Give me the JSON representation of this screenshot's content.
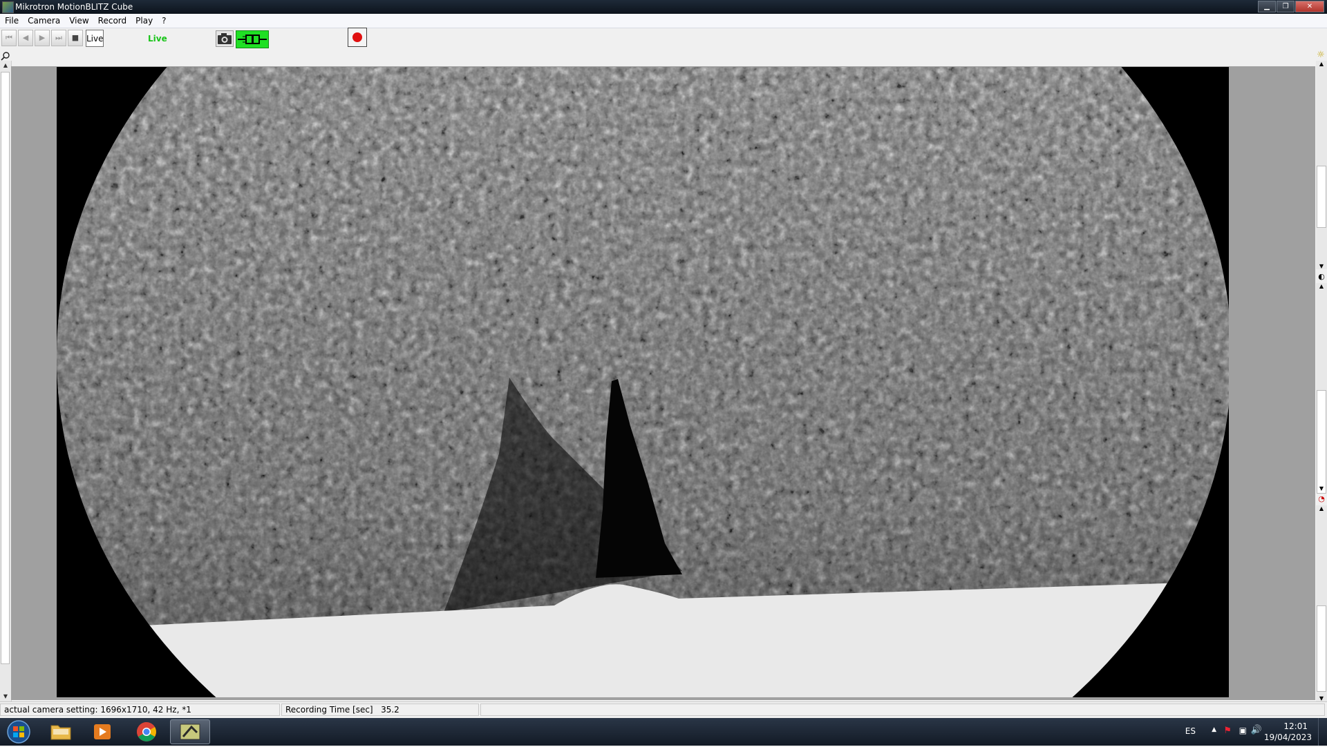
{
  "window": {
    "title": "Mikrotron MotionBLITZ Cube",
    "controls": [
      "minimize",
      "maximize",
      "close"
    ]
  },
  "menu": {
    "items": [
      "File",
      "Camera",
      "View",
      "Record",
      "Play",
      "?"
    ]
  },
  "toolbar": {
    "buttons": [
      {
        "name": "go-to-start-icon",
        "glyph": "⏮"
      },
      {
        "name": "step-back-icon",
        "glyph": "◀|"
      },
      {
        "name": "play-icon",
        "glyph": "▶"
      },
      {
        "name": "step-forward-icon",
        "glyph": "|▶"
      },
      {
        "name": "stop-icon",
        "glyph": "■"
      }
    ],
    "live_button_label": "Live",
    "live_status": "Live",
    "colors": {
      "live_status": "#19c419",
      "connect_button": "#1fe024",
      "record_button": "#e01010"
    }
  },
  "status_bar": {
    "camera_setting": "actual camera setting:  1696x1710, 42 Hz, *1",
    "recording_time_label": "Recording Time [sec]",
    "recording_time_value": "35.2"
  },
  "taskbar": {
    "apps": [
      "start-orb",
      "file-explorer",
      "media-player",
      "chrome",
      "motionblitz"
    ],
    "language": "ES",
    "time": "12:01",
    "date": "19/04/2023"
  }
}
